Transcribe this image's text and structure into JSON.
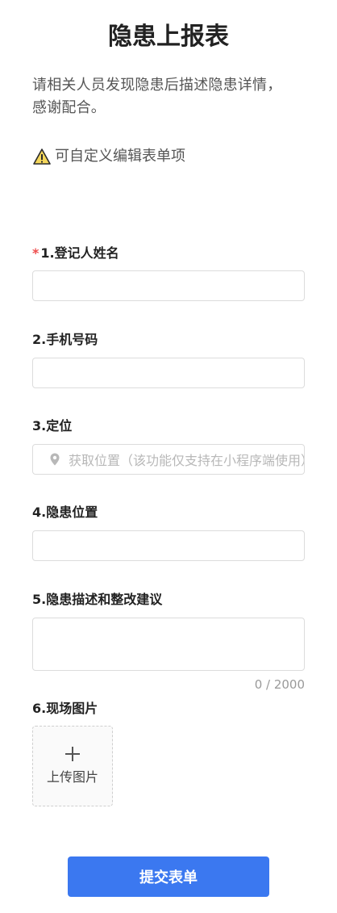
{
  "page": {
    "title": "隐患上报表",
    "description": "请相关人员发现隐患后描述隐患详情，感谢配合。",
    "tip": {
      "icon": "warning-icon",
      "text": "可自定义编辑表单项"
    }
  },
  "form": {
    "fields": [
      {
        "label": "1.登记人姓名",
        "required": true,
        "value": ""
      },
      {
        "label": "2.手机号码",
        "required": false,
        "value": ""
      },
      {
        "label": "3.定位",
        "required": false,
        "placeholder": "获取位置（该功能仅支持在小程序端使用）",
        "icon": "location-pin-icon"
      },
      {
        "label": "4.隐患位置",
        "required": false,
        "value": ""
      },
      {
        "label": "5.隐患描述和整改建议",
        "required": false,
        "counter": "0 / 2000"
      },
      {
        "label": "6.现场图片",
        "required": false
      }
    ],
    "upload": {
      "icon": "plus-icon",
      "label": "上传图片"
    },
    "submit_label": "提交表单"
  },
  "colors": {
    "primary": "#3b78f0",
    "required": "#ee4d4d"
  }
}
